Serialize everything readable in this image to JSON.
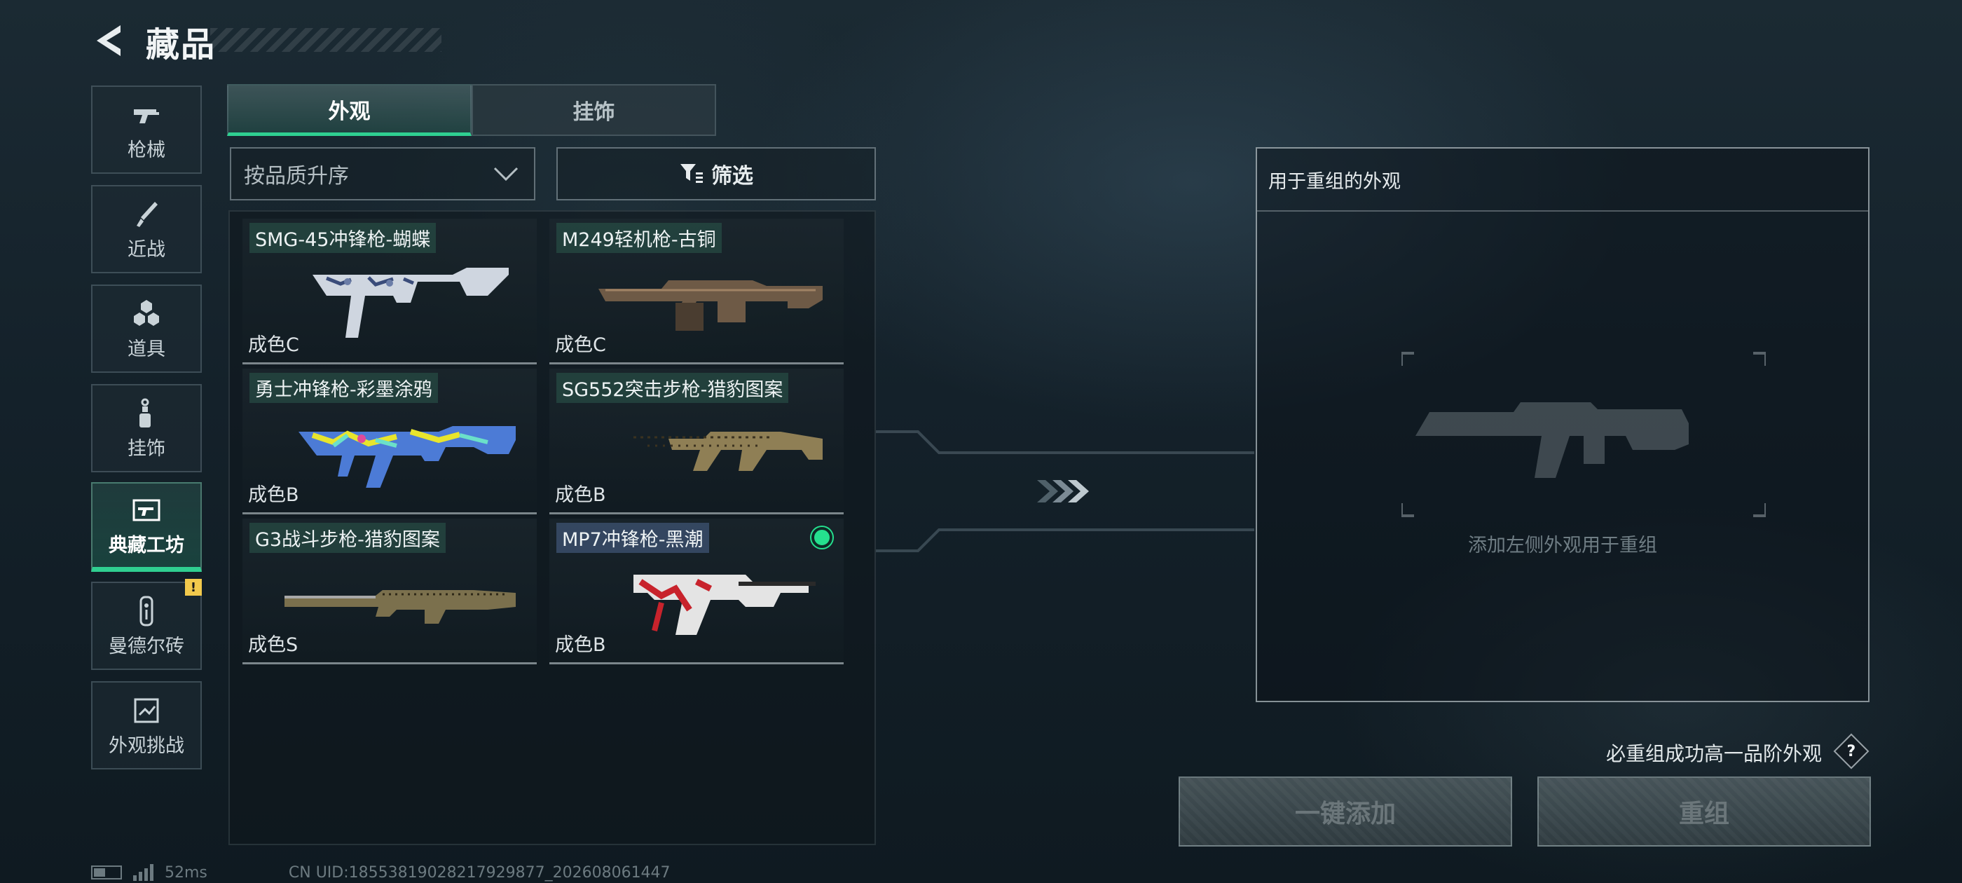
{
  "header": {
    "title": "藏品",
    "back_icon": "back-arrow-icon"
  },
  "nav": {
    "items": [
      {
        "label": "枪械",
        "icon": "rifle-icon"
      },
      {
        "label": "近战",
        "icon": "knife-icon"
      },
      {
        "label": "道具",
        "icon": "grenade-stack-icon"
      },
      {
        "label": "挂饰",
        "icon": "charm-icon"
      },
      {
        "label": "典藏工坊",
        "icon": "workshop-icon",
        "active": true
      },
      {
        "label": "曼德尔砖",
        "icon": "mandel-brick-icon",
        "badge": "!"
      },
      {
        "label": "外观挑战",
        "icon": "challenge-icon"
      }
    ]
  },
  "tabs": [
    {
      "label": "外观",
      "active": true
    },
    {
      "label": "挂饰",
      "active": false
    }
  ],
  "sort": {
    "label": "按品质升序"
  },
  "filter": {
    "label": "筛选"
  },
  "cards": [
    {
      "name": "SMG-45冲锋枪-蝴蝶",
      "grade": "成色C",
      "icon": "smg45-butterfly-skin"
    },
    {
      "name": "M249轻机枪-古铜",
      "grade": "成色C",
      "icon": "m249-bronze-skin"
    },
    {
      "name": "勇士冲锋枪-彩墨涂鸦",
      "grade": "成色B",
      "icon": "warrior-smg-graffiti-skin"
    },
    {
      "name": "SG552突击步枪-猎豹图案",
      "grade": "成色B",
      "icon": "sg552-cheetah-skin"
    },
    {
      "name": "G3战斗步枪-猎豹图案",
      "grade": "成色S",
      "icon": "g3-cheetah-skin"
    },
    {
      "name": "MP7冲锋枪-黑潮",
      "grade": "成色B",
      "icon": "mp7-black-tide-skin",
      "selected": true
    }
  ],
  "recombine": {
    "header": "用于重组的外观",
    "placeholder": "添加左侧外观用于重组",
    "hint": "必重组成功高一品阶外观",
    "help_label": "?"
  },
  "actions": {
    "add_all": "一键添加",
    "recombine": "重组"
  },
  "status": {
    "ping": "52ms",
    "uid": "CN UID:1855381902821792987​7_202608061447"
  },
  "colors": {
    "accent": "#2fcf91",
    "badge": "#f2c94c"
  }
}
